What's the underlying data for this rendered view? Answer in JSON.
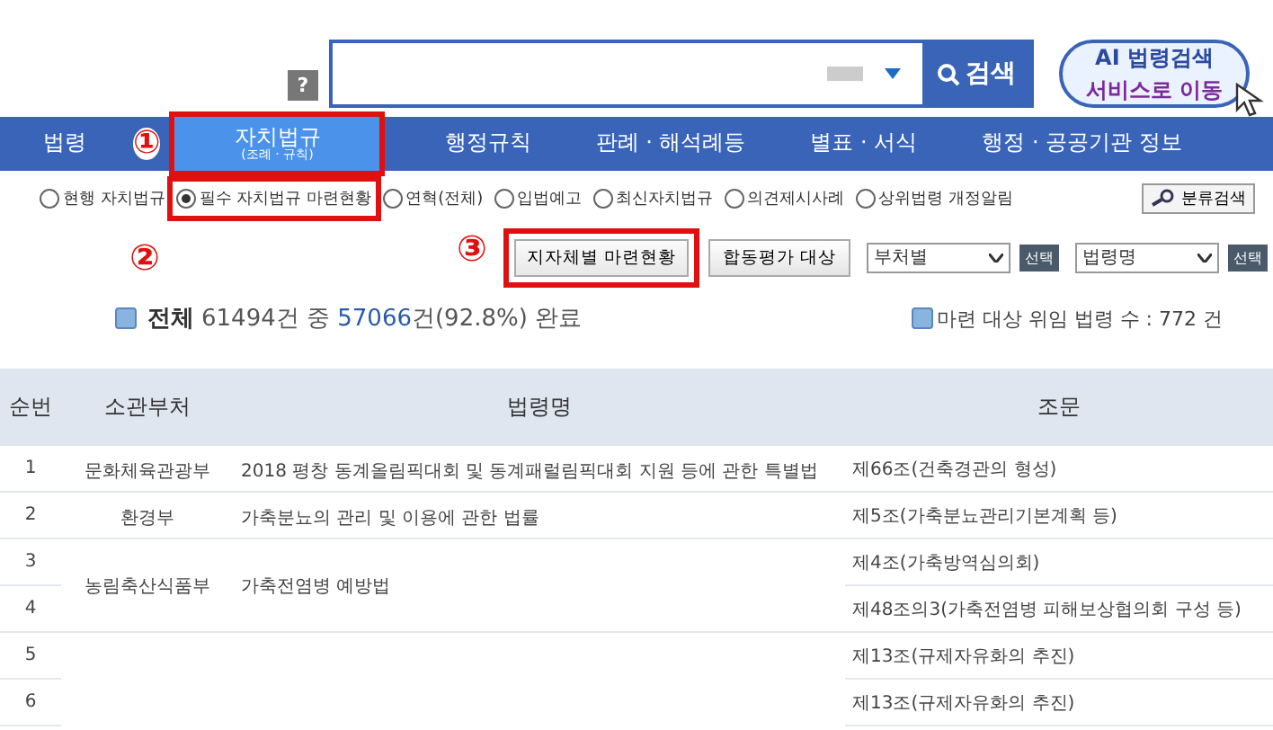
{
  "header": {
    "help_icon": "?",
    "search": {
      "button": "검색"
    },
    "ai_button": {
      "line_1": "AI 법령검색",
      "line_2": "서비스로 이동"
    }
  },
  "nav": [
    {
      "kind": "tab",
      "label": "법령",
      "selected": false,
      "highlighted": false
    },
    {
      "kind": "marker",
      "label": "①"
    },
    {
      "kind": "tab",
      "label": "자치법규",
      "sublabel": "(조례 · 규칙)",
      "selected": true,
      "highlighted": true
    },
    {
      "kind": "tab",
      "label": "행정규칙",
      "selected": false,
      "highlighted": false
    },
    {
      "kind": "tab",
      "label": "판례 · 해석례등",
      "selected": false,
      "highlighted": false
    },
    {
      "kind": "tab",
      "label": "별표 · 서식",
      "selected": false,
      "highlighted": false
    },
    {
      "kind": "tab",
      "label": "행정 · 공공기관 정보",
      "selected": false,
      "highlighted": false
    }
  ],
  "options": [
    {
      "label": "현행 자치법규",
      "selected": false,
      "highlighted": false
    },
    {
      "label": "필수 자치법규 마련현황",
      "selected": true,
      "highlighted": true
    },
    {
      "label": "연혁(전체)",
      "selected": false,
      "highlighted": false
    },
    {
      "label": "입법예고",
      "selected": false,
      "highlighted": false
    },
    {
      "label": "최신자치법규",
      "selected": false,
      "highlighted": false
    },
    {
      "label": "의견제시사례",
      "selected": false,
      "highlighted": false
    },
    {
      "label": "상위법령 개정알림",
      "selected": false,
      "highlighted": false
    }
  ],
  "category_search_button": "분류검색",
  "toolbar": [
    {
      "kind": "marker",
      "label": "②"
    },
    {
      "kind": "marker",
      "label": "③"
    },
    {
      "kind": "button",
      "label": "지자체별 마련현황",
      "highlighted": true
    },
    {
      "kind": "button",
      "label": "합동평가 대상",
      "highlighted": false
    },
    {
      "kind": "select",
      "label": "부처별"
    },
    {
      "kind": "small-button",
      "label": "선택"
    },
    {
      "kind": "select",
      "label": "법령명"
    },
    {
      "kind": "small-button",
      "label": "선택"
    }
  ],
  "summary": {
    "total_label": "전체",
    "total": "61494건 중",
    "done": "57066",
    "rest": "건(92.8%) 완료",
    "delegated": "마련 대상 위임 법령 수 : 772 건"
  },
  "table": {
    "columns": [
      "순번",
      "소관부처",
      "법령명",
      "조문"
    ],
    "rows": [
      {
        "no": "1",
        "department": "문화체육관광부",
        "law": "2018 평창 동계올림픽대회 및 동계패럴림픽대회 지원 등에 관한 특별법",
        "article": "제66조(건축경관의 형성)"
      },
      {
        "no": "2",
        "department": "환경부",
        "law": "가축분뇨의 관리 및 이용에 관한 법률",
        "article": "제5조(가축분뇨관리기본계획 등)"
      },
      {
        "no": "3",
        "department": "농림축산식품부",
        "law": "가축전염병 예방법",
        "article": "제4조(가축방역심의회)"
      },
      {
        "no": "4",
        "article": "제48조의3(가축전염병 피해보상협의회 구성 등)"
      },
      {
        "no": "5",
        "article": "제13조(규제자유화의 추진)"
      },
      {
        "no": "6",
        "article": "제13조(규제자유화의 추진)"
      }
    ]
  }
}
